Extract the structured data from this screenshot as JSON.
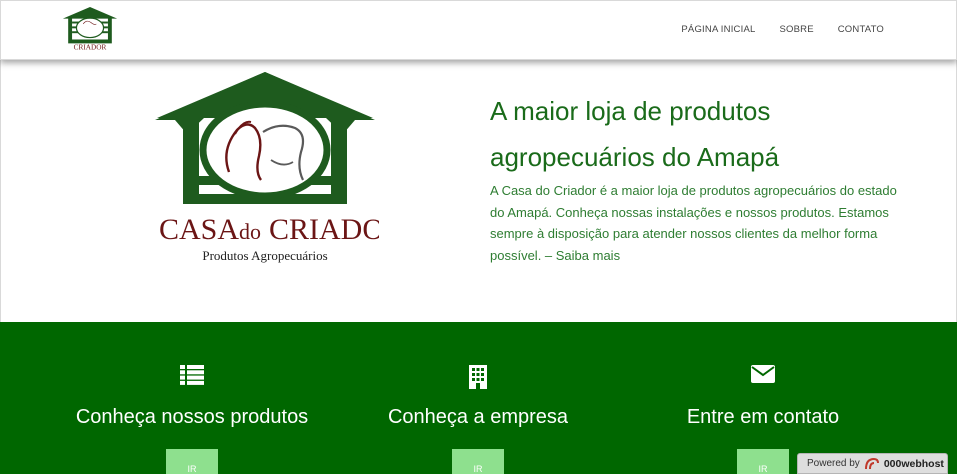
{
  "brand": {
    "name_main": "CASA",
    "name_do": "do",
    "name_end": "CRIADOR",
    "tagline": "Produtos Agropecuários"
  },
  "nav": {
    "items": [
      "PÁGINA INICIAL",
      "SOBRE",
      "CONTATO"
    ]
  },
  "hero": {
    "title": "A maior loja de produtos agropecuários do Amapá",
    "text": "A Casa do Criador é a maior loja de produtos agropecuários do estado do Amapá. Conheça nossas instalações e nossos produtos. Estamos sempre à disposição para atender nossos clientes da melhor forma possível. – Saiba mais"
  },
  "features": [
    {
      "icon": "list-icon",
      "title": "Conheça nossos produtos",
      "button": "IR"
    },
    {
      "icon": "building-icon",
      "title": "Conheça a empresa",
      "button": "IR"
    },
    {
      "icon": "envelope-icon",
      "title": "Entre em contato",
      "button": "IR"
    }
  ],
  "footer_badge": {
    "powered_by": "Powered by",
    "host": "000webhost"
  },
  "colors": {
    "brand_green": "#1a6b1a",
    "band_green": "#006700",
    "button_green": "#8ee08e",
    "logo_dark_green": "#1e5b1e",
    "logo_maroon": "#6b1515"
  }
}
